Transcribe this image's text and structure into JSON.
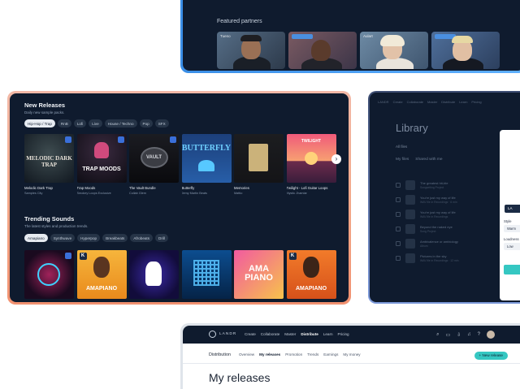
{
  "partners": {
    "title": "Featured partners",
    "cards": [
      {
        "label": "Tueno"
      },
      {
        "label": ""
      },
      {
        "label": "Aulart"
      },
      {
        "label": ""
      }
    ]
  },
  "releases": {
    "title": "New Releases",
    "subtitle": "Daily new sample packs.",
    "genres": [
      "Hip-Hop / Trap",
      "RnB",
      "Lofi",
      "Live",
      "House / Techno",
      "Pop",
      "SFX"
    ],
    "packs": [
      {
        "title": "Melodic Dark Trap",
        "author": "Samples City",
        "art_text": "MELODIC DARK TRAP"
      },
      {
        "title": "Trap Moods",
        "author": "Smokey Loops Exclusive",
        "art_text": "TRAP MOODS"
      },
      {
        "title": "The Vault Bundle",
        "author": "Collab Glem",
        "art_text": "VAULT"
      },
      {
        "title": "Butterfly",
        "author": "Jemy Martin Beats",
        "art_text": "BUTTERFLY"
      },
      {
        "title": "Memories",
        "author": "Mattio",
        "art_text": ""
      },
      {
        "title": "Twilight - Lofi Guitar Loops",
        "author": "Mystic Jhamlar",
        "art_text": "TWILIGHT"
      }
    ]
  },
  "trending": {
    "title": "Trending Sounds",
    "subtitle": "The latest styles and production trends.",
    "styles": [
      "Amapiano",
      "Synthwave",
      "Hyperpop",
      "Breakbeats",
      "Afrobeats",
      "Drill"
    ],
    "art": [
      {
        "art_text": ""
      },
      {
        "art_text": "AMAPIANO"
      },
      {
        "art_text": ""
      },
      {
        "art_text": ""
      },
      {
        "art_text": "AMA PIANO"
      },
      {
        "art_text": "AMAPIANO"
      }
    ]
  },
  "library": {
    "nav": [
      "LANDR",
      "Create",
      "Collaborate",
      "Master",
      "Distribute",
      "Learn",
      "Pricing"
    ],
    "title": "Library",
    "filter": "All files",
    "tabs": [
      "My files",
      "Shared with me"
    ],
    "rows": [
      {
        "title": "The greatest hit-ble",
        "sub": "Songwriting Project"
      },
      {
        "title": "You're just my way of life",
        "sub": "WAV file in Recordings · 6 min"
      },
      {
        "title": "You're just my way of life",
        "sub": "WAV file in Recordings"
      },
      {
        "title": "Beyond the naked eye",
        "sub": "Song Project"
      },
      {
        "title": "Ambivalence or ambiology",
        "sub": "Album"
      },
      {
        "title": "Pictures in the sky",
        "sub": "WAV file in Recordings · 12 min"
      }
    ],
    "panel": {
      "pill": "LA",
      "style_label": "Style",
      "style_value": "Warm",
      "loudness_label": "Loudness",
      "loudness_value": "Low"
    }
  },
  "distribution": {
    "brand": "LANDR",
    "nav": [
      "Create",
      "Collaborate",
      "Master",
      "Distribute",
      "Learn",
      "Pricing"
    ],
    "active_nav": "Distribute",
    "section": "Distribution",
    "subnav": [
      "Overview",
      "My releases",
      "Promotion",
      "Trends",
      "Earnings",
      "My money"
    ],
    "active_subnav": "My releases",
    "new_button": "+ New release",
    "page_title": "My releases"
  },
  "colors": {
    "dark_bg": "#0f1b2e",
    "teal_accent": "#35c7c2",
    "partners_border": "#3a8ee6",
    "releases_border": "#f3a98a"
  }
}
